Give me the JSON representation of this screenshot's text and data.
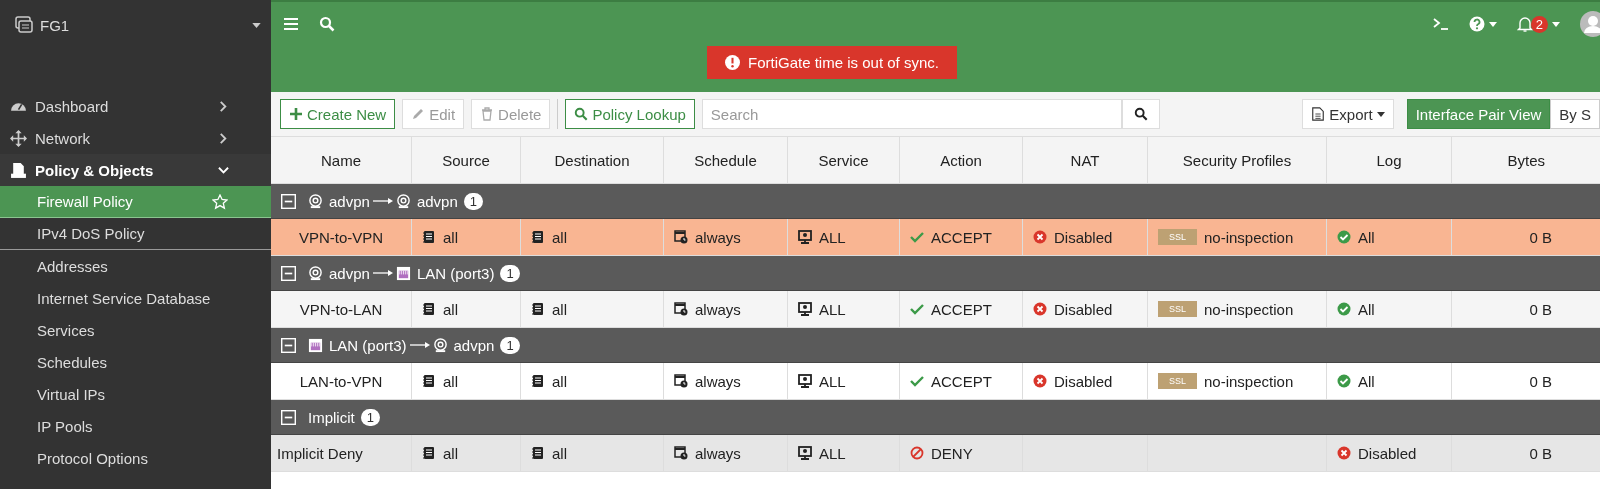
{
  "device": {
    "name": "FG1"
  },
  "sidebar": {
    "items": [
      {
        "label": "Dashboard",
        "expanded": false,
        "selected": false
      },
      {
        "label": "Network",
        "expanded": false,
        "selected": false
      },
      {
        "label": "Policy & Objects",
        "expanded": true,
        "selected": false,
        "children": [
          {
            "label": "Firewall Policy",
            "selected": true,
            "favorite": true
          },
          {
            "label": "IPv4 DoS Policy",
            "selected": false
          },
          {
            "label": "Addresses",
            "selected": false
          },
          {
            "label": "Internet Service Database",
            "selected": false
          },
          {
            "label": "Services",
            "selected": false
          },
          {
            "label": "Schedules",
            "selected": false
          },
          {
            "label": "Virtual IPs",
            "selected": false
          },
          {
            "label": "IP Pools",
            "selected": false
          },
          {
            "label": "Protocol Options",
            "selected": false
          }
        ]
      }
    ]
  },
  "top_bar": {
    "alert": "FortiGate time is out of sync.",
    "notification_count": "2"
  },
  "toolbar": {
    "buttons": [
      {
        "label": "Create New",
        "disabled": false
      },
      {
        "label": "Edit",
        "disabled": true
      },
      {
        "label": "Delete",
        "disabled": true
      }
    ],
    "lookup": "Policy Lookup",
    "search": {
      "placeholder": "Search"
    },
    "export": "Export",
    "views": [
      {
        "label": "Interface Pair View",
        "selected": true
      },
      {
        "label": "By S",
        "selected": false
      }
    ]
  },
  "table": {
    "columns": [
      "Name",
      "Source",
      "Destination",
      "Schedule",
      "Service",
      "Action",
      "NAT",
      "Security Profiles",
      "Log",
      "Bytes"
    ],
    "groups": [
      {
        "kind": "pair",
        "expanded": true,
        "from": {
          "kind": "tunnel",
          "label": "advpn"
        },
        "to": {
          "kind": "tunnel",
          "label": "advpn"
        },
        "count": "1",
        "rows": [
          {
            "kind": "policy",
            "selected": true,
            "name": "VPN-to-VPN",
            "source": "all",
            "destination": "all",
            "schedule": "always",
            "service": "ALL",
            "action": {
              "kind": "accept",
              "label": "ACCEPT"
            },
            "nat": {
              "label": "Disabled"
            },
            "security": {
              "badge": "SSL",
              "label": "no-inspection"
            },
            "log": {
              "kind": "enabled",
              "label": "All"
            },
            "bytes": "0 B"
          }
        ]
      },
      {
        "kind": "pair",
        "expanded": true,
        "from": {
          "kind": "tunnel",
          "label": "advpn"
        },
        "to": {
          "kind": "lan",
          "label": "LAN (port3)"
        },
        "count": "1",
        "rows": [
          {
            "kind": "policy",
            "selected": false,
            "name": "VPN-to-LAN",
            "source": "all",
            "destination": "all",
            "schedule": "always",
            "service": "ALL",
            "action": {
              "kind": "accept",
              "label": "ACCEPT"
            },
            "nat": {
              "label": "Disabled"
            },
            "security": {
              "badge": "SSL",
              "label": "no-inspection"
            },
            "log": {
              "kind": "enabled",
              "label": "All"
            },
            "bytes": "0 B"
          }
        ]
      },
      {
        "kind": "pair",
        "expanded": true,
        "from": {
          "kind": "lan",
          "label": "LAN (port3)"
        },
        "to": {
          "kind": "tunnel",
          "label": "advpn"
        },
        "count": "1",
        "rows": [
          {
            "kind": "policy",
            "selected": false,
            "name": "LAN-to-VPN",
            "source": "all",
            "destination": "all",
            "schedule": "always",
            "service": "ALL",
            "action": {
              "kind": "accept",
              "label": "ACCEPT"
            },
            "nat": {
              "label": "Disabled"
            },
            "security": {
              "badge": "SSL",
              "label": "no-inspection"
            },
            "log": {
              "kind": "enabled",
              "label": "All"
            },
            "bytes": "0 B"
          }
        ]
      },
      {
        "kind": "plain",
        "expanded": true,
        "label": "Implicit",
        "count": "1",
        "rows": [
          {
            "kind": "implicit",
            "selected": false,
            "name": "Implicit Deny",
            "source": "all",
            "destination": "all",
            "schedule": "always",
            "service": "ALL",
            "action": {
              "kind": "deny",
              "label": "DENY"
            },
            "log": {
              "kind": "disabled",
              "label": "Disabled"
            },
            "bytes": "0 B"
          }
        ]
      }
    ]
  }
}
